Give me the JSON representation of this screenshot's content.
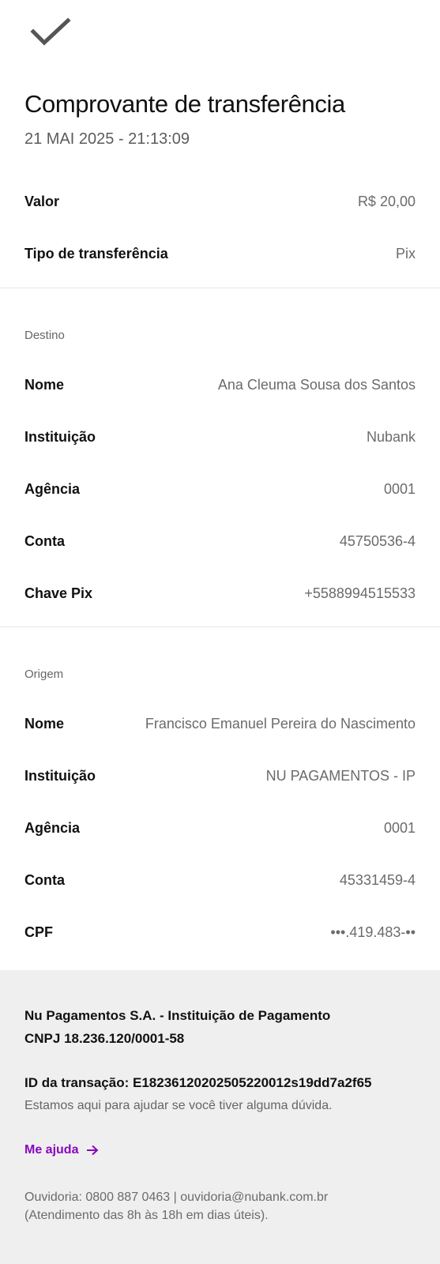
{
  "header": {
    "title": "Comprovante de transferência",
    "datetime": "21 MAI 2025 - 21:13:09"
  },
  "summary": [
    {
      "label": "Valor",
      "value": "R$ 20,00"
    },
    {
      "label": "Tipo de transferência",
      "value": "Pix"
    }
  ],
  "destino": {
    "title": "Destino",
    "rows": [
      {
        "label": "Nome",
        "value": "Ana Cleuma Sousa dos Santos"
      },
      {
        "label": "Instituição",
        "value": "Nubank"
      },
      {
        "label": "Agência",
        "value": "0001"
      },
      {
        "label": "Conta",
        "value": "45750536-4"
      },
      {
        "label": "Chave Pix",
        "value": "+5588994515533"
      }
    ]
  },
  "origem": {
    "title": "Origem",
    "rows": [
      {
        "label": "Nome",
        "value": "Francisco Emanuel Pereira do Nascimento"
      },
      {
        "label": "Instituição",
        "value": "NU PAGAMENTOS - IP"
      },
      {
        "label": "Agência",
        "value": "0001"
      },
      {
        "label": "Conta",
        "value": "45331459-4"
      },
      {
        "label": "CPF",
        "value": "•••.419.483-••"
      }
    ]
  },
  "footer": {
    "company": "Nu Pagamentos S.A. - Instituição de Pagamento",
    "cnpj": "CNPJ 18.236.120/0001-58",
    "transaction_id": "ID da transação: E18236120202505220012s19dd7a2f65",
    "help_text": "Estamos aqui para ajudar se você tiver alguma dúvida.",
    "help_link": "Me ajuda",
    "ombudsman": "Ouvidoria: 0800 887 0463 | ouvidoria@nubank.com.br",
    "hours": "(Atendimento das 8h às 18h em dias úteis)."
  },
  "icons": {
    "top": "checkmark-icon",
    "link": "arrow-right-icon"
  },
  "colors": {
    "accent": "#8a05be",
    "footer_bg": "#efefef"
  }
}
